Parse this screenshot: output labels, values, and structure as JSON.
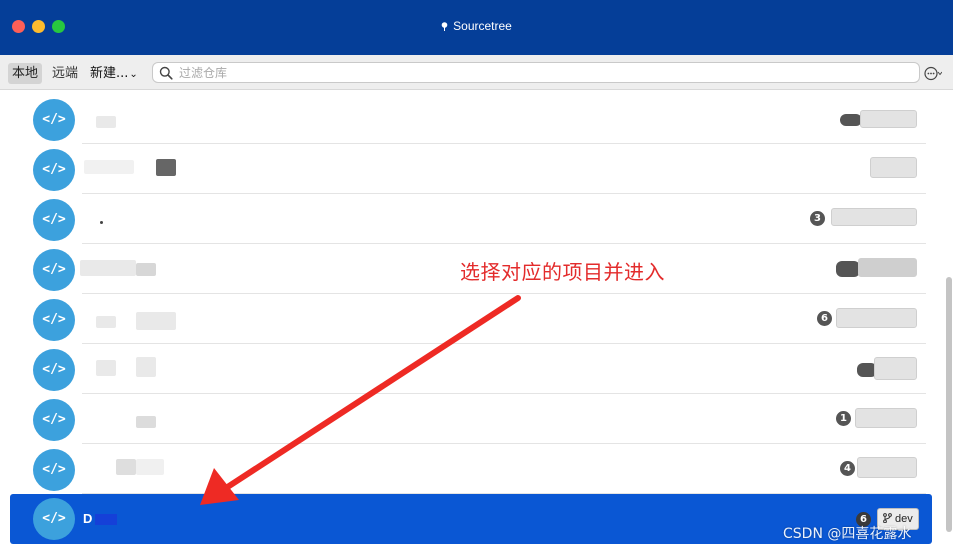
{
  "window": {
    "title": "Sourcetree"
  },
  "toolbar": {
    "local_tab": "本地",
    "remote_tab": "远端",
    "new_menu": "新建...",
    "search_placeholder": "过滤仓库"
  },
  "repo_icon_glyph": "</>",
  "rows": [
    {
      "badge": ""
    },
    {
      "badge": ""
    },
    {
      "badge": "3"
    },
    {
      "badge": ""
    },
    {
      "badge": "6"
    },
    {
      "badge": ""
    },
    {
      "badge": "1"
    },
    {
      "badge": "4"
    }
  ],
  "selected_row": {
    "name": "D",
    "badge": "6",
    "branch": "dev"
  },
  "annotation": {
    "text": "选择对应的项目并进入",
    "color": "#e32b2b"
  },
  "watermark": "CSDN @四喜花露水",
  "colors": {
    "titlebar": "#053e98",
    "selection": "#0a57d4",
    "avatar": "#3ca1dd"
  }
}
